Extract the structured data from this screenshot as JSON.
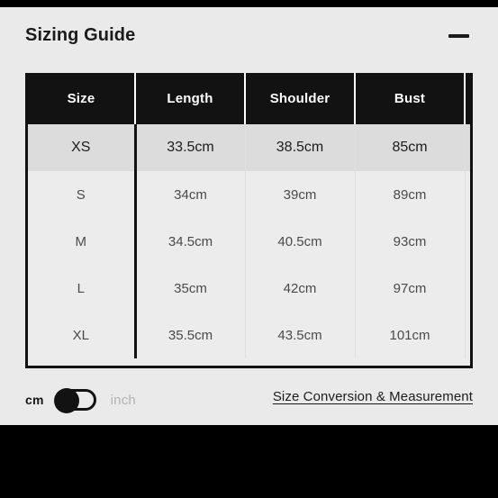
{
  "panel": {
    "title": "Sizing Guide",
    "minimize_icon": "minimize-dash-icon"
  },
  "table": {
    "columns": [
      "Size",
      "Length",
      "Shoulder",
      "Bust"
    ],
    "rows": [
      {
        "size": "XS",
        "length": "33.5cm",
        "shoulder": "38.5cm",
        "bust": "85cm",
        "active": true
      },
      {
        "size": "S",
        "length": "34cm",
        "shoulder": "39cm",
        "bust": "89cm",
        "active": false
      },
      {
        "size": "M",
        "length": "34.5cm",
        "shoulder": "40.5cm",
        "bust": "93cm",
        "active": false
      },
      {
        "size": "L",
        "length": "35cm",
        "shoulder": "42cm",
        "bust": "97cm",
        "active": false
      },
      {
        "size": "XL",
        "length": "35.5cm",
        "shoulder": "43.5cm",
        "bust": "101cm",
        "active": false
      }
    ]
  },
  "footer": {
    "unit_cm": "cm",
    "unit_inch": "inch",
    "unit_selected": "cm",
    "conversion_link": "Size Conversion & Measurement"
  },
  "colors": {
    "card_background": "#eaeaea",
    "table_header_background": "#121212",
    "table_header_text": "#ffffff",
    "row_background": "#ececec",
    "row_active_background": "#dcdcdc",
    "body_text": "#4a4a4a",
    "title_text": "#1b1b1b",
    "inactive_unit_text": "#b3b3b3",
    "letterbox": "#000000"
  }
}
